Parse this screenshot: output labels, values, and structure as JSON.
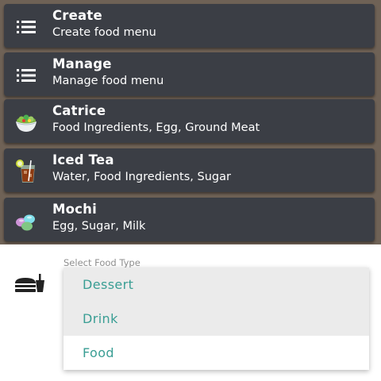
{
  "menu": {
    "items": [
      {
        "title": "Create",
        "subtitle": "Create food menu",
        "icon": "list-icon"
      },
      {
        "title": "Manage",
        "subtitle": "Manage food menu",
        "icon": "list-icon"
      },
      {
        "title": "Catrice",
        "subtitle": "Food Ingredients, Egg, Ground Meat",
        "icon": "salad-bowl-icon"
      },
      {
        "title": "Iced Tea",
        "subtitle": "Water, Food Ingredients, Sugar",
        "icon": "iced-tea-icon"
      },
      {
        "title": "Mochi",
        "subtitle": "Egg, Sugar, Milk",
        "icon": "mochi-icon"
      }
    ]
  },
  "food_type": {
    "label": "Select Food Type",
    "icon": "fast-food-icon",
    "options": [
      "Dessert",
      "Drink",
      "Food"
    ],
    "highlighted": [
      "Dessert",
      "Drink"
    ]
  },
  "colors": {
    "background": "#6f6256",
    "card": "#3b3e45",
    "card_text": "#ffffff",
    "option_text": "#3a9e94",
    "option_highlight": "#ebebeb",
    "label": "#8f8f8f"
  }
}
